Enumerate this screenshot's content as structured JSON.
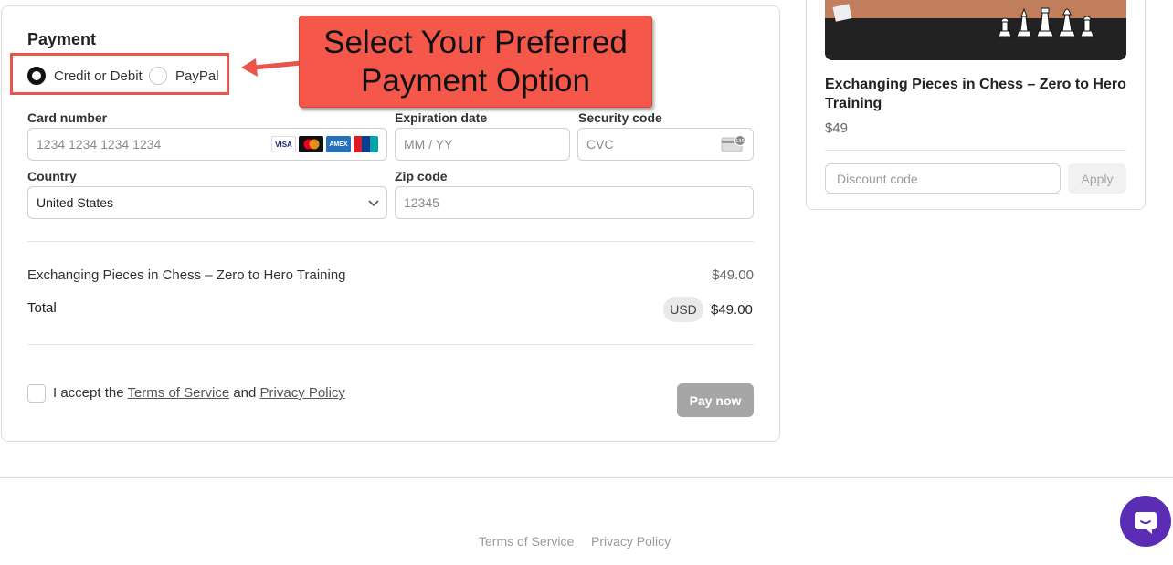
{
  "payment": {
    "title": "Payment",
    "methods": [
      {
        "label": "Credit or Debit",
        "selected": true
      },
      {
        "label": "PayPal",
        "selected": false
      }
    ]
  },
  "annotation": {
    "line1": "Select Your Preferred",
    "line2": "Payment Option",
    "color": "#f5574b"
  },
  "card_form": {
    "card_number_label": "Card number",
    "card_number_placeholder": "1234 1234 1234 1234",
    "card_brands": [
      "VISA",
      "mastercard",
      "AMEX",
      "UnionPay"
    ],
    "expiration_label": "Expiration date",
    "expiration_placeholder": "MM / YY",
    "security_label": "Security code",
    "security_placeholder": "CVC",
    "country_label": "Country",
    "country_value": "United States",
    "zip_label": "Zip code",
    "zip_placeholder": "12345"
  },
  "summary": {
    "item_name": "Exchanging Pieces in Chess – Zero to Hero Training",
    "item_price": "$49.00",
    "total_label": "Total",
    "currency": "USD",
    "total_value": "$49.00"
  },
  "terms": {
    "prefix": "I accept the",
    "tos_link": "Terms of Service",
    "and": "and",
    "privacy_link": "Privacy Policy"
  },
  "pay_button": "Pay now",
  "sidebar": {
    "product_title": "Exchanging Pieces in Chess – Zero to Hero Training",
    "product_price": "$49",
    "discount_placeholder": "Discount code",
    "apply_label": "Apply"
  },
  "footer": {
    "tos": "Terms of Service",
    "privacy": "Privacy Policy"
  },
  "colors": {
    "accent_annotation": "#f5574b",
    "chat_button": "#5b2db5",
    "pay_button_disabled": "#a6a6a6"
  }
}
